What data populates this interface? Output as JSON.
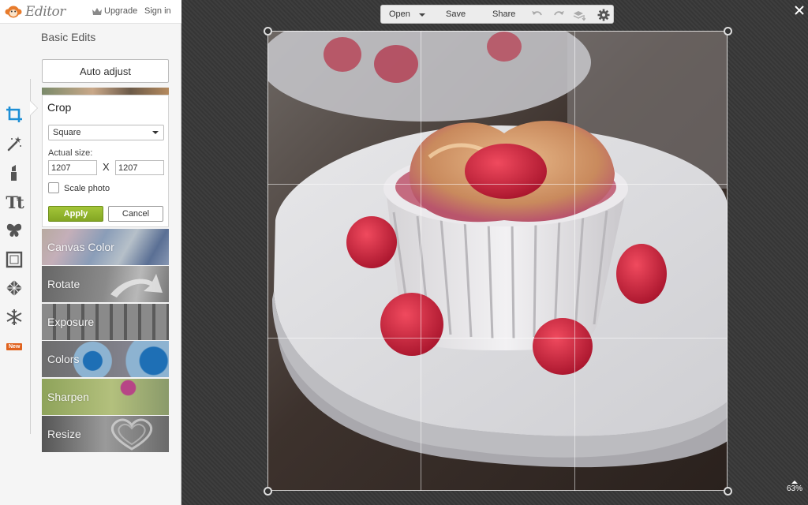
{
  "app": {
    "brand": "Editor",
    "upgrade_label": "Upgrade",
    "signin_label": "Sign in"
  },
  "sidebar": {
    "section_title": "Basic Edits",
    "auto_adjust_label": "Auto adjust",
    "tools": [
      {
        "name": "crop-tool",
        "icon": "crop-icon"
      },
      {
        "name": "effects-tool",
        "icon": "magic-wand-icon"
      },
      {
        "name": "touch-up-tool",
        "icon": "lipstick-icon"
      },
      {
        "name": "text-tool",
        "icon": "text-icon",
        "glyph": "Tt"
      },
      {
        "name": "overlays-tool",
        "icon": "butterfly-icon"
      },
      {
        "name": "frames-tool",
        "icon": "frame-icon"
      },
      {
        "name": "textures-tool",
        "icon": "texture-icon"
      },
      {
        "name": "seasonal-tool",
        "icon": "snowflake-icon",
        "badge": "New"
      }
    ],
    "crop": {
      "title": "Crop",
      "aspect_value": "Square",
      "size_label": "Actual size:",
      "width": "1207",
      "height": "1207",
      "separator": "X",
      "scale_label": "Scale photo",
      "scale_checked": false,
      "apply_label": "Apply",
      "cancel_label": "Cancel"
    },
    "tiles": [
      "Canvas Color",
      "Rotate",
      "Exposure",
      "Colors",
      "Sharpen",
      "Resize"
    ]
  },
  "toolbar": {
    "open_label": "Open",
    "save_label": "Save",
    "share_label": "Share",
    "icons": [
      "undo-icon",
      "redo-icon",
      "layers-icon",
      "gear-icon"
    ]
  },
  "canvas": {
    "zoom": "63%"
  },
  "colors": {
    "apply_green": "#8fb52b",
    "badge_orange": "#e0621e",
    "workspace_bg": "#3a3a3a"
  }
}
